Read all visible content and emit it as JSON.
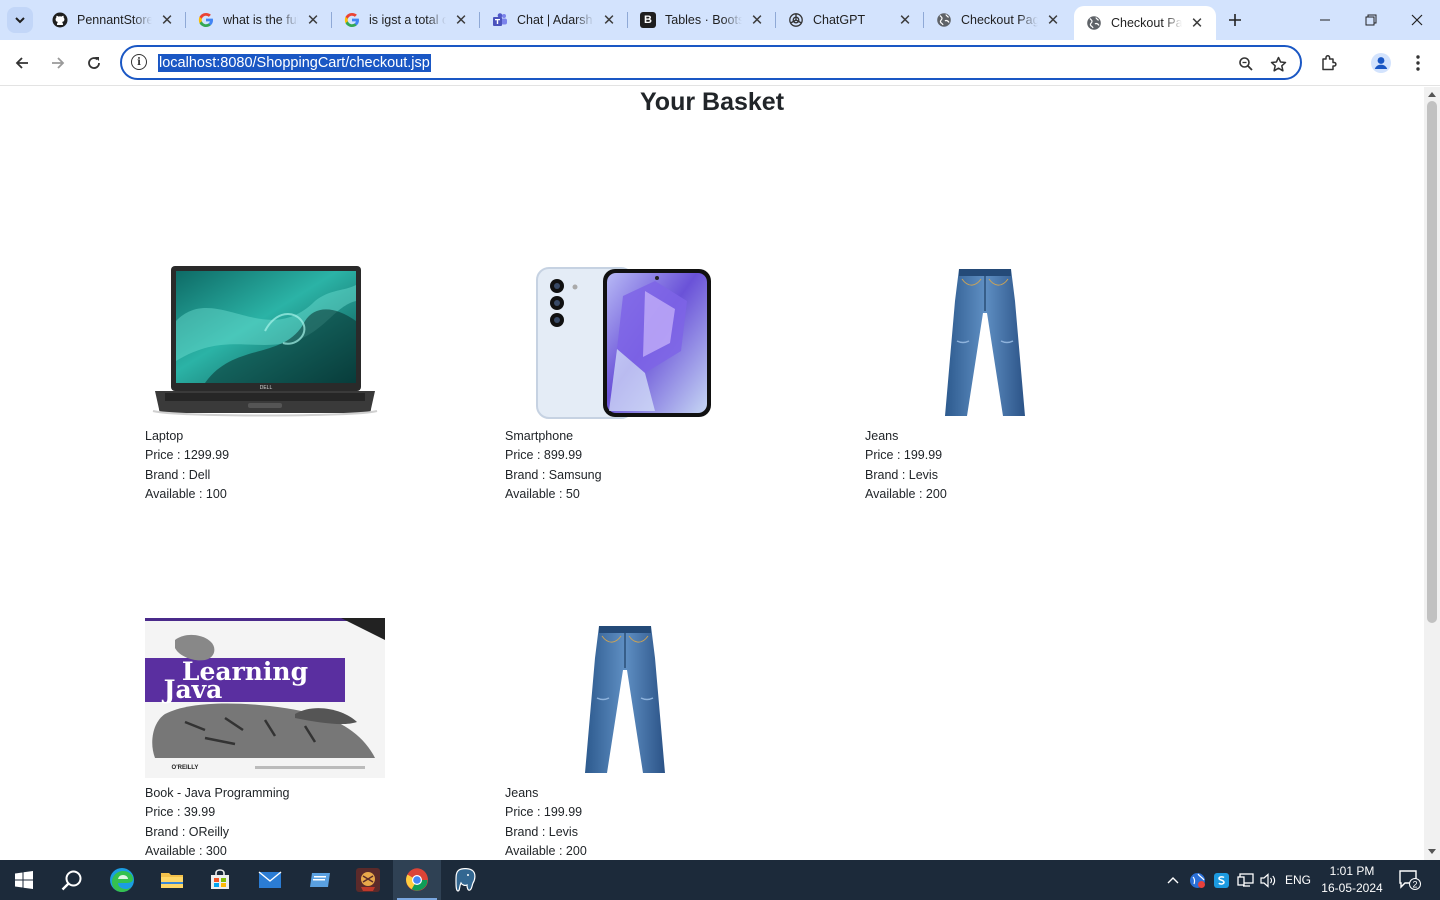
{
  "browser": {
    "tabs": [
      {
        "title": "PennantStore/",
        "icon": "github-icon"
      },
      {
        "title": "what is the full",
        "icon": "google-icon"
      },
      {
        "title": "is igst a total o",
        "icon": "google-icon"
      },
      {
        "title": "Chat | Adarsh P",
        "icon": "teams-icon"
      },
      {
        "title": "Tables · Bootstr",
        "icon": "bootstrap-icon"
      },
      {
        "title": "ChatGPT",
        "icon": "chatgpt-icon"
      },
      {
        "title": "Checkout Page",
        "icon": "globe-icon"
      },
      {
        "title": "Checkout Page",
        "icon": "globe-icon",
        "active": true
      }
    ],
    "bootstrap_letter": "B",
    "address": "localhost:8080/ShoppingCart/checkout.jsp",
    "info_glyph": "i"
  },
  "page": {
    "title": "Your Basket",
    "products": [
      {
        "name": "Laptop",
        "price": "Price : 1299.99",
        "brand": "Brand : Dell",
        "available": "Available : 100",
        "image": "laptop-image"
      },
      {
        "name": "Smartphone",
        "price": "Price : 899.99",
        "brand": "Brand : Samsung",
        "available": "Available : 50",
        "image": "smartphone-image"
      },
      {
        "name": "Jeans",
        "price": "Price : 199.99",
        "brand": "Brand : Levis",
        "available": "Available : 200",
        "image": "jeans-image"
      },
      {
        "name": "Book - Java Programming",
        "price": "Price : 39.99",
        "brand": "Brand : OReilly",
        "available": "Available : 300",
        "image": "book-image"
      },
      {
        "name": "Jeans",
        "price": "Price : 199.99",
        "brand": "Brand : Levis",
        "available": "Available : 200",
        "image": "jeans-image"
      }
    ],
    "book_cover": {
      "line1": "Learning",
      "line2": "Java",
      "publisher": "O'REILLY"
    },
    "laptop_badge": "DELL"
  },
  "taskbar": {
    "language": "ENG",
    "time": "1:01 PM",
    "date": "16-05-2024",
    "notification_count": "2"
  }
}
